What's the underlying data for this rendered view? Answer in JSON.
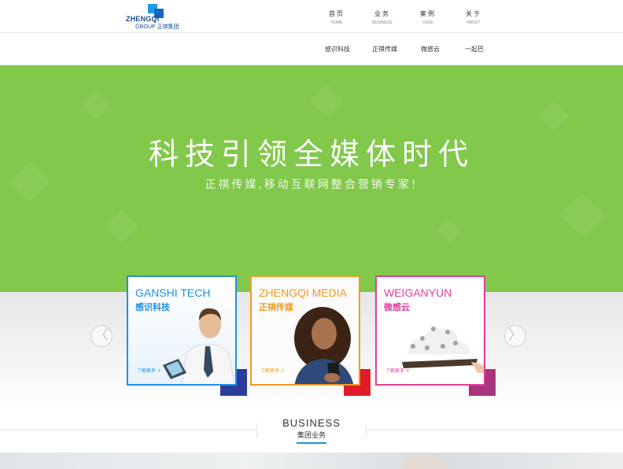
{
  "logo": {
    "brand": "ZHENGQI",
    "sub": "GROUP 正祺集团"
  },
  "nav": [
    {
      "cn": "首页",
      "en": "HOME"
    },
    {
      "cn": "业务",
      "en": "BUSINESS"
    },
    {
      "cn": "案例",
      "en": "CASE"
    },
    {
      "cn": "关于",
      "en": "ABOUT"
    }
  ],
  "subnav": [
    "感识科技",
    "正祺传媒",
    "微感云",
    "一起巴"
  ],
  "banner": {
    "title": "科技引领全媒体时代",
    "subtitle": "正祺传媒,移动互联网整合营销专家!",
    "color": "#82c84b"
  },
  "arrows": {
    "prev": "〈",
    "next": "〉"
  },
  "cards": [
    {
      "en": "GANSHI TECH",
      "cn": "感识科技",
      "more": "了解更多 +",
      "color": "#1e90e6",
      "shadow": "#2a3d9c"
    },
    {
      "en": "ZHENGQI MEDIA",
      "cn": "正祺传媒",
      "more": "了解更多 +",
      "color": "#f39a1f",
      "shadow": "#e01b28"
    },
    {
      "en": "WEIGANYUN",
      "cn": "微感云",
      "more": "了解更多 +",
      "color": "#e23c9c",
      "shadow": "#a8347e"
    }
  ],
  "section": {
    "en": "BUSINESS",
    "cn": "集团业务",
    "accent": "#1e90e6"
  }
}
